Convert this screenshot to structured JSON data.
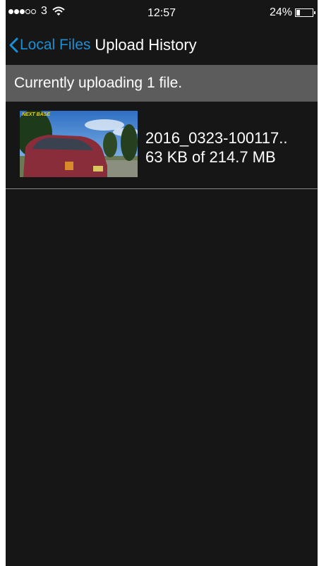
{
  "status_bar": {
    "carrier": "3",
    "time": "12:57",
    "battery_percent_label": "24%",
    "battery_level": 0.24
  },
  "nav": {
    "back_label": "Local Files",
    "title": "Upload History"
  },
  "banner": {
    "text": "Currently uploading 1 file."
  },
  "uploads": [
    {
      "file_name": "2016_0323-100117..",
      "progress_text": "63 KB of 214.7 MB",
      "thumbnail_logo": "NEXT BASE"
    }
  ],
  "colors": {
    "accent": "#1a8fd6",
    "background": "#161616",
    "banner": "#5c5c5c"
  },
  "icons": [
    "signal-icon",
    "wifi-icon",
    "battery-icon",
    "chevron-left-icon"
  ]
}
